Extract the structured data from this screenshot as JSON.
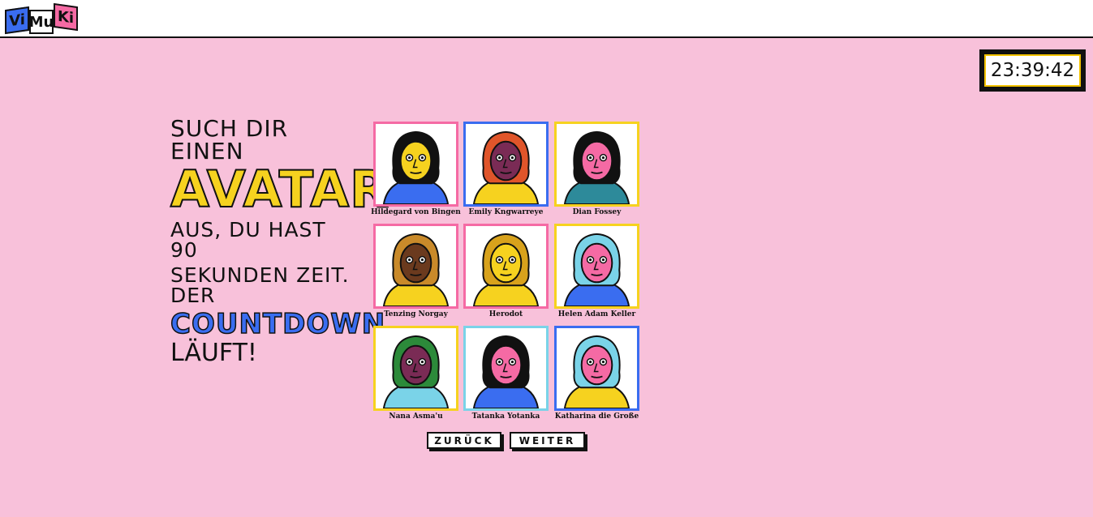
{
  "header": {
    "logo_letters": [
      "Vi",
      "Mu",
      "Ki"
    ],
    "logo_colors": [
      "#3a6df0",
      "#ffffff",
      "#f56aa4"
    ]
  },
  "timer": {
    "value": "23:39:42"
  },
  "headline": {
    "line1": "Such dir einen",
    "line2": "Avatar",
    "line3": "aus, du hast 90",
    "line4": "Sekunden Zeit. Der",
    "line5": "Countdown",
    "line6": "läuft!"
  },
  "avatars": [
    {
      "name": "Hildegard von Bingen",
      "border": "#f56aa4",
      "skin": "#f6d21f",
      "hair": "#111111",
      "shirt": "#3a6df0"
    },
    {
      "name": "Emily Kngwarreye",
      "border": "#3a6df0",
      "skin": "#7a2b55",
      "hair": "#e0552a",
      "shirt": "#f6d21f"
    },
    {
      "name": "Dian Fossey",
      "border": "#f6d21f",
      "skin": "#f56aa4",
      "hair": "#111111",
      "shirt": "#2d8a9a"
    },
    {
      "name": "Tenzing Norgay",
      "border": "#f56aa4",
      "skin": "#6b3a1e",
      "hair": "#c98a2a",
      "shirt": "#f6d21f"
    },
    {
      "name": "Herodot",
      "border": "#f56aa4",
      "skin": "#f6d21f",
      "hair": "#d8a21c",
      "shirt": "#f6d21f"
    },
    {
      "name": "Helen Adam Keller",
      "border": "#f6d21f",
      "skin": "#f56aa4",
      "hair": "#7ad3e8",
      "shirt": "#3a6df0"
    },
    {
      "name": "Nana Asma'u",
      "border": "#f6d21f",
      "skin": "#7a2b55",
      "hair": "#2c8a3a",
      "shirt": "#7ad3e8"
    },
    {
      "name": "Tatanka Yotanka",
      "border": "#7ad3e8",
      "skin": "#f56aa4",
      "hair": "#111111",
      "shirt": "#3a6df0"
    },
    {
      "name": "Katharina die Große",
      "border": "#3a6df0",
      "skin": "#f56aa4",
      "hair": "#7ad3e8",
      "shirt": "#f6d21f"
    }
  ],
  "buttons": {
    "back": "ZURÜCK",
    "next": "WEITER"
  }
}
